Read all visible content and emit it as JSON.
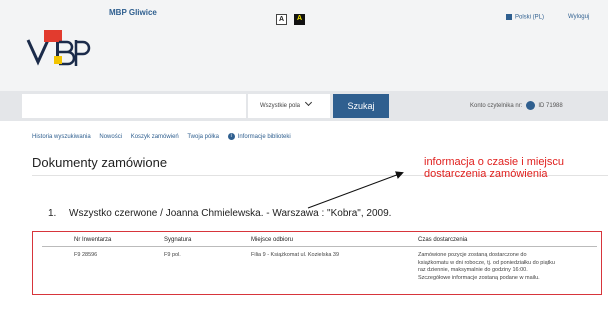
{
  "header": {
    "library_name": "MBP Gliwice",
    "logo_text": "MBP",
    "contrast_normal": "A",
    "contrast_high": "A",
    "language": "Polski (PL)",
    "logout": "Wyloguj"
  },
  "search": {
    "placeholder": "",
    "field_select": "Wszystkie pola",
    "button": "Szukaj"
  },
  "account": {
    "label": "Konto czytelnika nr:",
    "id": "ID 71988"
  },
  "nav": {
    "items": [
      "Historia wyszukiwania",
      "Nowości",
      "Koszyk zamówień",
      "Twoja półka"
    ],
    "info": "Informacje biblioteki"
  },
  "page": {
    "title": "Dokumenty zamówione"
  },
  "annotation": {
    "line1": "informacja o czasie i miejscu",
    "line2": "dostarczenia zamówienia"
  },
  "record": {
    "number": "1.",
    "title": "Wszystko czerwone / Joanna Chmielewska. - Warszawa : \"Kobra\", 2009."
  },
  "table": {
    "headers": [
      "Nr Inwentarza",
      "Sygnatura",
      "Miejsce odbioru",
      "Czas dostarczenia"
    ],
    "row": {
      "inventory": "F9 28596",
      "signature": "F9 pol.",
      "pickup": "Filia 9 - Książkomat ul. Kozielska 39",
      "delivery_lines": [
        "Zamówione pozycje zostaną dostarczone do",
        "książkomatu w dni robocze, tj. od poniedziałku do piątku",
        "raz dziennie, maksymalnie do godziny 16:00.",
        "Szczegółowe informacje zostaną podane w mailu."
      ]
    }
  },
  "colors": {
    "brand": "#2f5f8f",
    "annotation": "#e0201e",
    "highlight_border": "#d7353b"
  }
}
